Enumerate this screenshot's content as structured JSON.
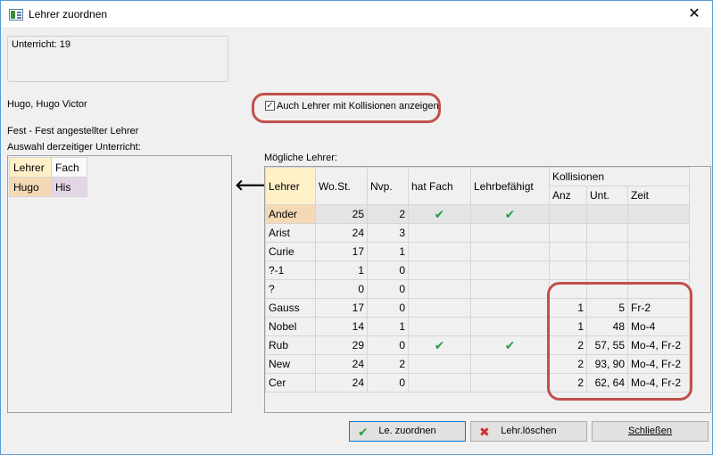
{
  "window": {
    "title": "Lehrer zuordnen",
    "close": "✕"
  },
  "unterricht": "Unterricht: 19",
  "teacher_name": "Hugo, Hugo Victor",
  "fest_label": "Fest - Fest angestellter Lehrer",
  "auswahl_label": "Auswahl derzeitiger Unterricht:",
  "current": {
    "headers": [
      "Lehrer",
      "Fach"
    ],
    "row": [
      "Hugo",
      "His"
    ]
  },
  "arrow": "🡐",
  "checkbox": {
    "label": "Auch Lehrer mit Kollisionen anzeigen",
    "checked": true,
    "mark": "✓"
  },
  "moegliche_label": "Mögliche Lehrer:",
  "grid": {
    "headers": {
      "lehrer": "Lehrer",
      "wost": "Wo.St.",
      "nvp": "Nvp.",
      "hatfach": "hat Fach",
      "lehrbef": "Lehrbefähigt",
      "kollisionen": "Kollisionen",
      "anz": "Anz",
      "unt": "Unt.",
      "zeit": "Zeit"
    },
    "rows": [
      {
        "lehrer": "Ander",
        "wost": "25",
        "nvp": "2",
        "hatfach": "✔",
        "lehrbef": "✔",
        "anz": "",
        "unt": "",
        "zeit": ""
      },
      {
        "lehrer": "Arist",
        "wost": "24",
        "nvp": "3",
        "hatfach": "",
        "lehrbef": "",
        "anz": "",
        "unt": "",
        "zeit": ""
      },
      {
        "lehrer": "Curie",
        "wost": "17",
        "nvp": "1",
        "hatfach": "",
        "lehrbef": "",
        "anz": "",
        "unt": "",
        "zeit": ""
      },
      {
        "lehrer": "?-1",
        "wost": "1",
        "nvp": "0",
        "hatfach": "",
        "lehrbef": "",
        "anz": "",
        "unt": "",
        "zeit": ""
      },
      {
        "lehrer": "?",
        "wost": "0",
        "nvp": "0",
        "hatfach": "",
        "lehrbef": "",
        "anz": "",
        "unt": "",
        "zeit": ""
      },
      {
        "lehrer": "Gauss",
        "wost": "17",
        "nvp": "0",
        "hatfach": "",
        "lehrbef": "",
        "anz": "1",
        "unt": "5",
        "zeit": "Fr-2"
      },
      {
        "lehrer": "Nobel",
        "wost": "14",
        "nvp": "1",
        "hatfach": "",
        "lehrbef": "",
        "anz": "1",
        "unt": "48",
        "zeit": "Mo-4"
      },
      {
        "lehrer": "Rub",
        "wost": "29",
        "nvp": "0",
        "hatfach": "✔",
        "lehrbef": "✔",
        "anz": "2",
        "unt": "57, 55",
        "zeit": "Mo-4, Fr-2"
      },
      {
        "lehrer": "New",
        "wost": "24",
        "nvp": "2",
        "hatfach": "",
        "lehrbef": "",
        "anz": "2",
        "unt": "93, 90",
        "zeit": "Mo-4, Fr-2"
      },
      {
        "lehrer": "Cer",
        "wost": "24",
        "nvp": "0",
        "hatfach": "",
        "lehrbef": "",
        "anz": "2",
        "unt": "62, 64",
        "zeit": "Mo-4, Fr-2"
      }
    ]
  },
  "buttons": {
    "zuordnen": "Le. zuordnen",
    "zuordnen_icon": "✔",
    "loeschen": "Lehr.löschen",
    "loeschen_icon": "✖",
    "schliessen": "Schließen"
  },
  "colors": {
    "highlight": "#c0504d",
    "check": "#2ea043",
    "delete": "#d32f2f"
  }
}
